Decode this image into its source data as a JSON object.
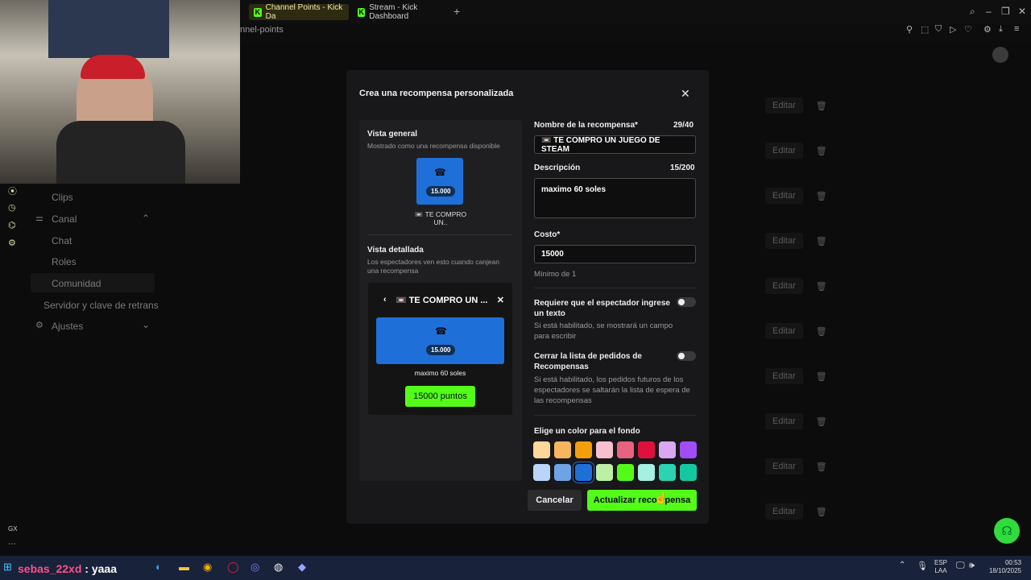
{
  "browser": {
    "tabs": [
      {
        "label": "Channel Points - Kick Da"
      },
      {
        "label": "Stream - Kick Dashboard"
      }
    ],
    "url_fragment": "nnel-points",
    "gx_label": "GX"
  },
  "sidebar": {
    "items": [
      {
        "label": "Clips"
      },
      {
        "label": "Canal"
      },
      {
        "label": "Chat"
      },
      {
        "label": "Roles"
      },
      {
        "label": "Comunidad"
      },
      {
        "label": "Servidor y clave de retrans"
      },
      {
        "label": "Ajustes"
      }
    ]
  },
  "background_rows": {
    "edit_label": "Editar",
    "trash_icon": "trash-icon"
  },
  "modal": {
    "title": "Crea una recompensa personalizada",
    "overview": {
      "heading": "Vista general",
      "subheading": "Mostrado como una recompensa disponible",
      "cost_badge": "15.000",
      "reward_name_short": "📼 TE COMPRO UN.."
    },
    "detail": {
      "heading": "Vista detallada",
      "subheading": "Los espectadores ven esto cuando canjean una recompensa",
      "title": "📼 TE COMPRO UN ...",
      "cost_badge": "15.000",
      "description": "maximo 60 soles",
      "points_button": "15000 puntos"
    },
    "form": {
      "name_label": "Nombre de la recompensa*",
      "name_count": "29/40",
      "name_value": "📼 TE COMPRO UN JUEGO DE STEAM",
      "description_label": "Descripción",
      "description_count": "15/200",
      "description_value": "maximo 60 soles",
      "cost_label": "Costo*",
      "cost_value": "15000",
      "cost_hint": "Mínimo de 1",
      "require_text_label": "Requiere que el espectador ingrese un texto",
      "require_text_hint": "Si está habilitado, se mostrará un campo para escribir",
      "skip_queue_label": "Cerrar la lista de pedidos de Recompensas",
      "skip_queue_hint": "Si está habilitado, los pedidos futuros de los espectadores se saltarán la lista de espera de las recompensas",
      "color_label": "Elige un color para el fondo",
      "colors_row1": [
        "#fcd79b",
        "#f7b55e",
        "#f59e0b",
        "#f8bfcf",
        "#e8637f",
        "#e0103d",
        "#d8a8f0",
        "#a24cf5"
      ],
      "colors_row2": [
        "#b9d6f8",
        "#6ea3e6",
        "#1f6fd9",
        "#bdf0a5",
        "#53fc18",
        "#a5f0e0",
        "#2ad4b0",
        "#14c9a0"
      ],
      "selected_color": "#1f6fd9"
    },
    "cancel_button": "Cancelar",
    "update_button": "Actualizar recompensa"
  },
  "taskbar": {
    "overlay_user": "sebas_22xd",
    "overlay_message": ": yaaa",
    "lang_top": "ESP",
    "lang_bottom": "LAA",
    "time": "00:53",
    "date": "18/10/2025"
  }
}
